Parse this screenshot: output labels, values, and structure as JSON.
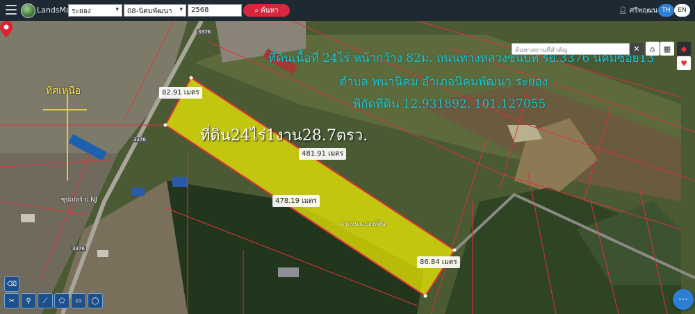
{
  "header": {
    "brand": "LandsMaps",
    "province_select": "ระยอง",
    "district_select": "08-นิคมพัฒนา",
    "year_input": "2568",
    "search_button": "ค้นหา",
    "user_name": "ศรีพฤฒนา",
    "lang_th": "TH",
    "lang_en": "EN"
  },
  "map": {
    "search_placeholder": "ค้นหาสถานที่สำคัญ",
    "headline_line1": "ที่ดินเนื้อที่ 24ไร่ หน้ากว้าง 82ม. ถนนทางหลวงชนบท รย.3376 นิคมซอย13",
    "headline_line2": "ตำบล พนานิคม อำเภอนิคมพัฒนา ระยอง",
    "headline_line3": "พิกัดที่ดิน 12.931892, 101.127055",
    "area_label": "ที่ดิน24ไร่1งาน28.7ตรว.",
    "north_label": "ทิศเหนือ",
    "distances": {
      "front": "82.91 เมตร",
      "top_side": "481.91 เมตร",
      "bottom_side": "478.19 เมตร",
      "back": "86.84 เมตร"
    },
    "road_labels": [
      "3376",
      "3376",
      "3376"
    ],
    "poi_shop": "ซุปเปอร์ ป.NJ",
    "pin_label": "ตำแหน่งแปลงที่ดิน",
    "parcel_color": "#f3f000",
    "boundary_color": "#e0313a"
  },
  "icons": {
    "menu": "menu-icon",
    "logo": "logo-icon",
    "user": "user-icon",
    "search": "search-icon",
    "home": "home-icon",
    "grid": "grid-icon",
    "layers": "layers-icon",
    "favorite": "heart-icon",
    "chat": "chat-icon"
  }
}
